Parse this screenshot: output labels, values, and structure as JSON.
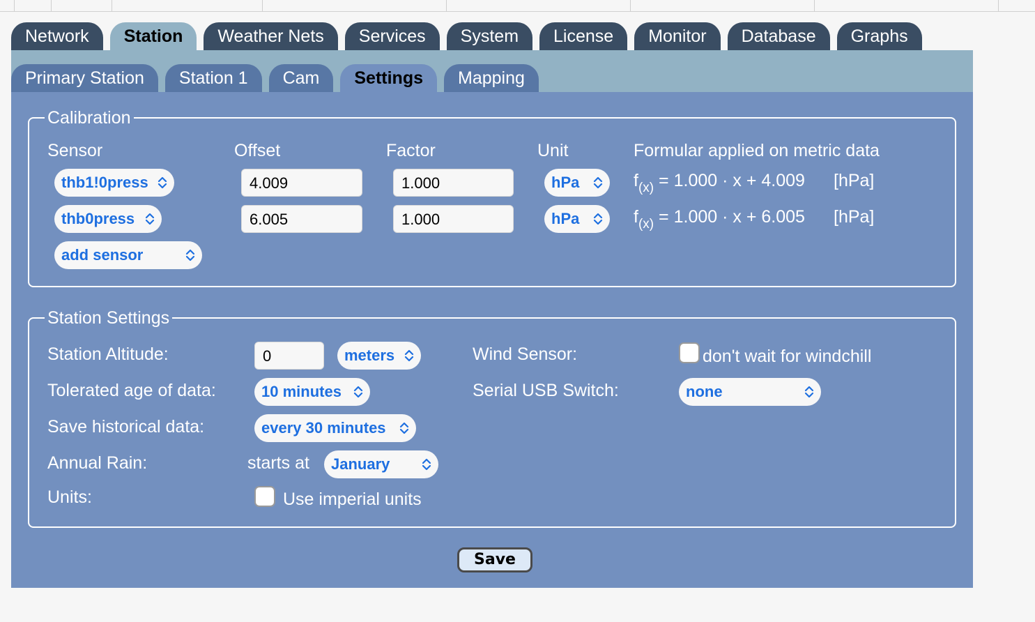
{
  "main_tabs": [
    {
      "label": "Network",
      "active": false
    },
    {
      "label": "Station",
      "active": true
    },
    {
      "label": "Weather Nets",
      "active": false
    },
    {
      "label": "Services",
      "active": false
    },
    {
      "label": "System",
      "active": false
    },
    {
      "label": "License",
      "active": false
    },
    {
      "label": "Monitor",
      "active": false
    },
    {
      "label": "Database",
      "active": false
    },
    {
      "label": "Graphs",
      "active": false
    }
  ],
  "sub_tabs": [
    {
      "label": "Primary Station",
      "active": false
    },
    {
      "label": "Station 1",
      "active": false
    },
    {
      "label": "Cam",
      "active": false
    },
    {
      "label": "Settings",
      "active": true
    },
    {
      "label": "Mapping",
      "active": false
    }
  ],
  "calibration": {
    "legend": "Calibration",
    "headers": {
      "sensor": "Sensor",
      "offset": "Offset",
      "factor": "Factor",
      "unit": "Unit",
      "formula": "Formular applied on metric data"
    },
    "rows": [
      {
        "sensor": "thb1!0press",
        "offset": "4.009",
        "factor": "1.000",
        "unit": "hPa",
        "formula_prefix": "f",
        "formula_sub": "(x)",
        "formula_body": " = 1.000 · x + 4.009",
        "formula_unit": "[hPa]"
      },
      {
        "sensor": "thb0press",
        "offset": "6.005",
        "factor": "1.000",
        "unit": "hPa",
        "formula_prefix": "f",
        "formula_sub": "(x)",
        "formula_body": " = 1.000 · x + 6.005",
        "formula_unit": "[hPa]"
      }
    ],
    "add_sensor": "add sensor"
  },
  "station_settings": {
    "legend": "Station Settings",
    "altitude_label": "Station Altitude:",
    "altitude_value": "0",
    "altitude_unit": "meters",
    "age_label": "Tolerated age of data:",
    "age_value": "10 minutes",
    "history_label": "Save historical data:",
    "history_value": "every 30 minutes",
    "rain_label": "Annual Rain:",
    "rain_starts": "starts at",
    "rain_month": "January",
    "units_label": "Units:",
    "imperial_label": "Use imperial units",
    "imperial_checked": false,
    "wind_label": "Wind Sensor:",
    "windchill_label": "don't wait for windchill",
    "windchill_checked": false,
    "usb_label": "Serial USB Switch:",
    "usb_value": "none"
  },
  "save_label": "Save",
  "colors": {
    "tab_dark": "#3a4d63",
    "tab_active": "#92b2c4",
    "subtab": "#5877a5",
    "panel": "#7390bf",
    "select_text": "#1e6fe0"
  }
}
